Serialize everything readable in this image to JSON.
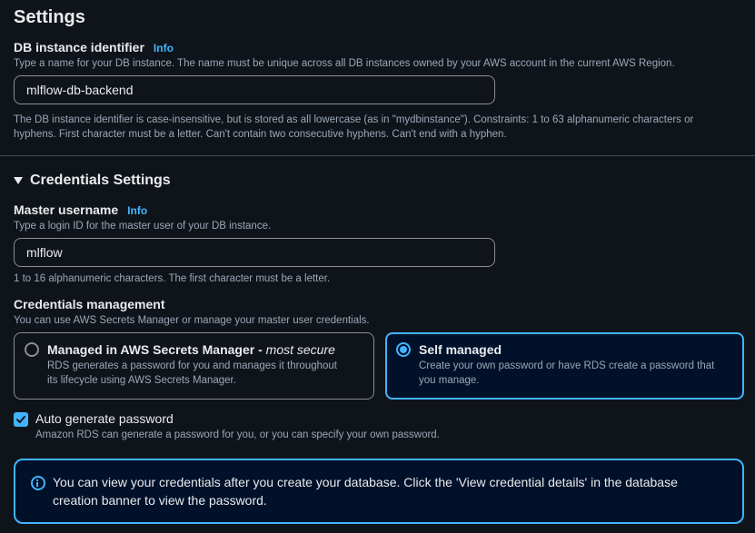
{
  "settings": {
    "title": "Settings",
    "db_identifier": {
      "label": "DB instance identifier",
      "info": "Info",
      "description": "Type a name for your DB instance. The name must be unique across all DB instances owned by your AWS account in the current AWS Region.",
      "value": "mlflow-db-backend",
      "constraint_line1": "The DB instance identifier is case-insensitive, but is stored as all lowercase (as in \"mydbinstance\"). Constraints: 1 to 63 alphanumeric characters or",
      "constraint_line2": "hyphens. First character must be a letter. Can't contain two consecutive hyphens. Can't end with a hyphen."
    }
  },
  "credentials": {
    "title": "Credentials Settings",
    "master_username": {
      "label": "Master username",
      "info": "Info",
      "description": "Type a login ID for the master user of your DB instance.",
      "value": "mlflow",
      "constraint": "1 to 16 alphanumeric characters. The first character must be a letter."
    },
    "management": {
      "label": "Credentials management",
      "description": "You can use AWS Secrets Manager or manage your master user credentials.",
      "options": [
        {
          "title": "Managed in AWS Secrets Manager",
          "emphasis": "most secure",
          "separator": " - ",
          "desc_line1": "RDS generates a password for you and manages it throughout",
          "desc_line2": "its lifecycle using AWS Secrets Manager.",
          "selected": false
        },
        {
          "title": "Self managed",
          "desc_line1": "Create your own password or have RDS create a password that",
          "desc_line2": "you manage.",
          "selected": true
        }
      ]
    },
    "auto_generate": {
      "label": "Auto generate password",
      "description": "Amazon RDS can generate a password for you, or you can specify your own password.",
      "checked": true
    },
    "alert": {
      "line1": "You can view your credentials after you create your database. Click the 'View credential details' in the database",
      "line2": "creation banner to view the password."
    }
  },
  "colors": {
    "background": "#0f141a",
    "accent": "#42b4ff",
    "selected_tile_bg": "#001129",
    "text_primary": "#e9ebed",
    "text_secondary": "#9ba7b6",
    "border": "#8c8c94"
  }
}
